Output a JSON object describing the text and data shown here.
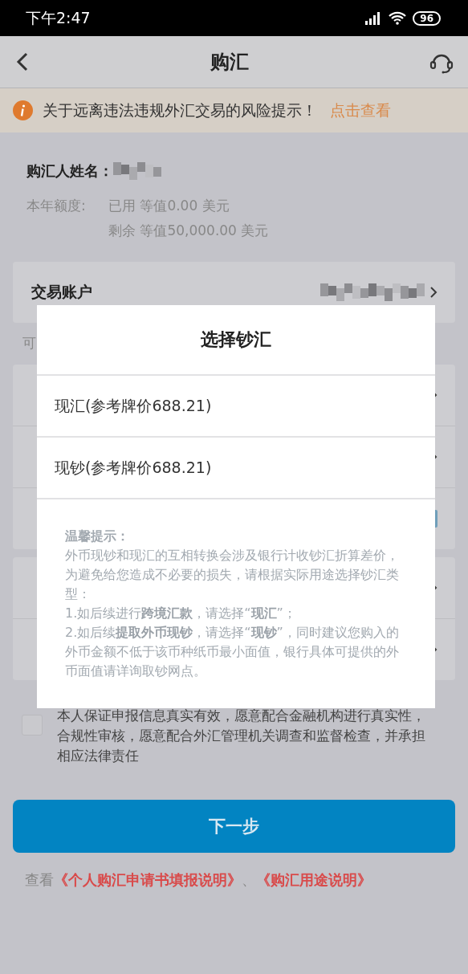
{
  "status_bar": {
    "time": "下午2:47",
    "battery": "96"
  },
  "nav": {
    "title": "购汇"
  },
  "notice": {
    "text": "关于远离违法违规外汇交易的风险提示！",
    "link": "点击查看"
  },
  "buyer": {
    "label": "购汇人姓名："
  },
  "quota": {
    "label": "本年额度:",
    "lines": [
      "已用 等值0.00 美元",
      "剩余 等值50,000.00 美元"
    ]
  },
  "account_row": {
    "label": "交易账户"
  },
  "hint_fragment": "可",
  "modal": {
    "title": "选择钞汇",
    "options": [
      {
        "label": "现汇(参考牌价688.21)",
        "selected": false
      },
      {
        "label": "现钞(参考牌价688.21)",
        "selected": false
      }
    ],
    "tip_title": "温馨提示：",
    "tip_lines": [
      "外币现钞和现汇的互相转换会涉及银行计收钞汇折算差价，为避免给您造成不必要的损失，请根据实际用途选择钞汇类型：",
      "1.如后续进行**跨境汇款**，请选择“**现汇**”；",
      "2.如后续**提取外币现钞**，请选择“**现钞**”，同时建议您购入的外币金额不低于该币种纸币最小面值，银行具体可提供的外币面值请详询取钞网点。"
    ]
  },
  "agreement": {
    "checked": false,
    "text": "本人保证申报信息真实有效，愿意配合金融机构进行真实性，合规性审核，愿意配合外汇管理机关调查和监督检查，并承担相应法律责任"
  },
  "next_button": "下一步",
  "footer": {
    "prefix": "查看",
    "links": [
      "《个人购汇申请书填报说明》",
      "《购汇用途说明》"
    ],
    "separator": "、"
  }
}
